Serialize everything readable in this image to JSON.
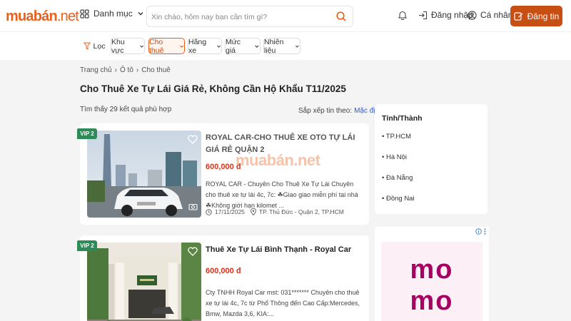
{
  "header": {
    "logo": "muabán",
    "logo_suffix": ".net",
    "category_label": "Danh mục",
    "search_placeholder": "Xin chào, hôm nay bạn cần tìm gì?",
    "login_label": "Đăng nhập",
    "profile_label": "Cá nhân",
    "post_label": "Đăng tin"
  },
  "filters": [
    {
      "label": "Lọc",
      "icon": "funnel-icon"
    },
    {
      "label": "Khu vực"
    },
    {
      "label": "Cho thuê",
      "active": true
    },
    {
      "label": "Hãng xe"
    },
    {
      "label": "Mức giá"
    },
    {
      "label": "Nhiên liệu"
    }
  ],
  "breadcrumb": [
    "Trang chủ",
    "Ô tô",
    "Cho thuê"
  ],
  "page_title": "Cho Thuê Xe Tự Lái Giá Rẻ, Không Cần Hộ Khẩu T11/2025",
  "result_count": "Tìm thấy 29 kết quả phù hợp",
  "sort": {
    "label": "Sắp xếp tin theo:",
    "value": "Mặc định"
  },
  "listings": [
    {
      "badge": "VIP 2",
      "title": "ROYAL CAR-CHO THUÊ XE OTO TỰ LÁI GIÁ RẺ QUẬN 2",
      "price": "600,000 đ",
      "description": "ROYAL CAR - Chuyên Cho Thuê Xe Tự Lái Chuyên cho thuê xe tự lái 4c, 7c: ☘Giao giao miễn phí tại nhà ☘Không giới hạn kilomet ...",
      "date": "17/11/2025",
      "location": "TP. Thủ Đức - Quận 2,  TP.HCM"
    },
    {
      "badge": "VIP 2",
      "title": "Thuê Xe Tự Lái Bình Thạnh - Royal Car",
      "price": "600,000 đ",
      "description": "Cty TNHH Royal Car mst: 031******* Chuyên cho thuê xe tự lái 4c, 7c từ Phổ Thông đến Cao Cấp:Mercedes, Bmw, Mazda 3,6, KIA:..."
    }
  ],
  "region_panel": {
    "title": "Tỉnh/Thành",
    "items": [
      "TP.HCM",
      "Hà Nội",
      "Đà Nẵng",
      "Đồng Nai"
    ]
  },
  "ad": {
    "brand_line1": "mo",
    "brand_line2": "mo"
  },
  "watermark": "muabán.net",
  "colors": {
    "brand": "#e8601c",
    "post_button": "#c84f14",
    "price": "#d4341c",
    "vip": "#2e8b57",
    "momo": "#a50064"
  }
}
